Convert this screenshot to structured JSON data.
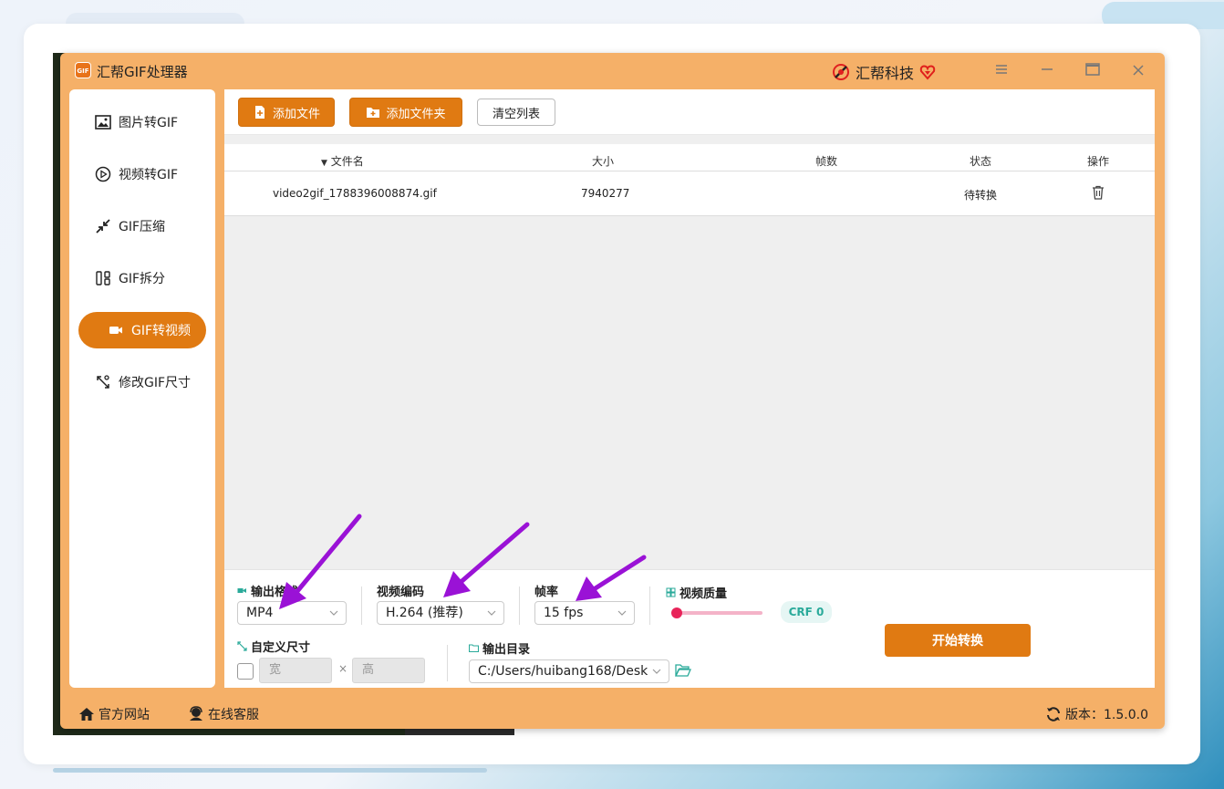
{
  "app": {
    "title": "汇帮GIF处理器",
    "logo_text": "GIF",
    "brand": "汇帮科技"
  },
  "sidebar": {
    "items": [
      {
        "label": "图片转GIF",
        "icon": "image-icon",
        "active": false
      },
      {
        "label": "视频转GIF",
        "icon": "play-circle-icon",
        "active": false
      },
      {
        "label": "GIF压缩",
        "icon": "compress-arrows-icon",
        "active": false
      },
      {
        "label": "GIF拆分",
        "icon": "split-grid-icon",
        "active": false
      },
      {
        "label": "GIF转视频",
        "icon": "video-camera-icon",
        "active": true
      },
      {
        "label": "修改GIF尺寸",
        "icon": "resize-icon",
        "active": false
      }
    ]
  },
  "toolbar": {
    "add_file": "添加文件",
    "add_folder": "添加文件夹",
    "clear_list": "清空列表"
  },
  "table": {
    "headers": {
      "name": "文件名",
      "size": "大小",
      "frames": "帧数",
      "status": "状态",
      "action": "操作"
    },
    "rows": [
      {
        "name": "video2gif_1788396008874.gif",
        "size": "7940277",
        "frames": "",
        "status": "待转换"
      }
    ]
  },
  "settings": {
    "output_format": {
      "label": "输出格式",
      "value": "MP4"
    },
    "video_codec": {
      "label": "视频编码",
      "value": "H.264 (推荐)"
    },
    "frame_rate": {
      "label": "帧率",
      "value": "15 fps"
    },
    "video_quality": {
      "label": "视频质量",
      "crf_label": "CRF 0",
      "crf_value": 0
    },
    "custom_size": {
      "label": "自定义尺寸",
      "width_placeholder": "宽",
      "height_placeholder": "高",
      "separator": "×",
      "checked": false
    },
    "output_dir": {
      "label": "输出目录",
      "value": "C:/Users/huibang168/Desk"
    },
    "start_button": "开始转换"
  },
  "footer": {
    "website": "官方网站",
    "support": "在线客服",
    "version": "版本：1.5.0.0"
  },
  "colors": {
    "accent": "#e07a12",
    "frame": "#f5b068",
    "annotation_arrow": "#9a12d6",
    "slider_knob": "#e8245a",
    "crf_badge_text": "#2aaa9a"
  }
}
